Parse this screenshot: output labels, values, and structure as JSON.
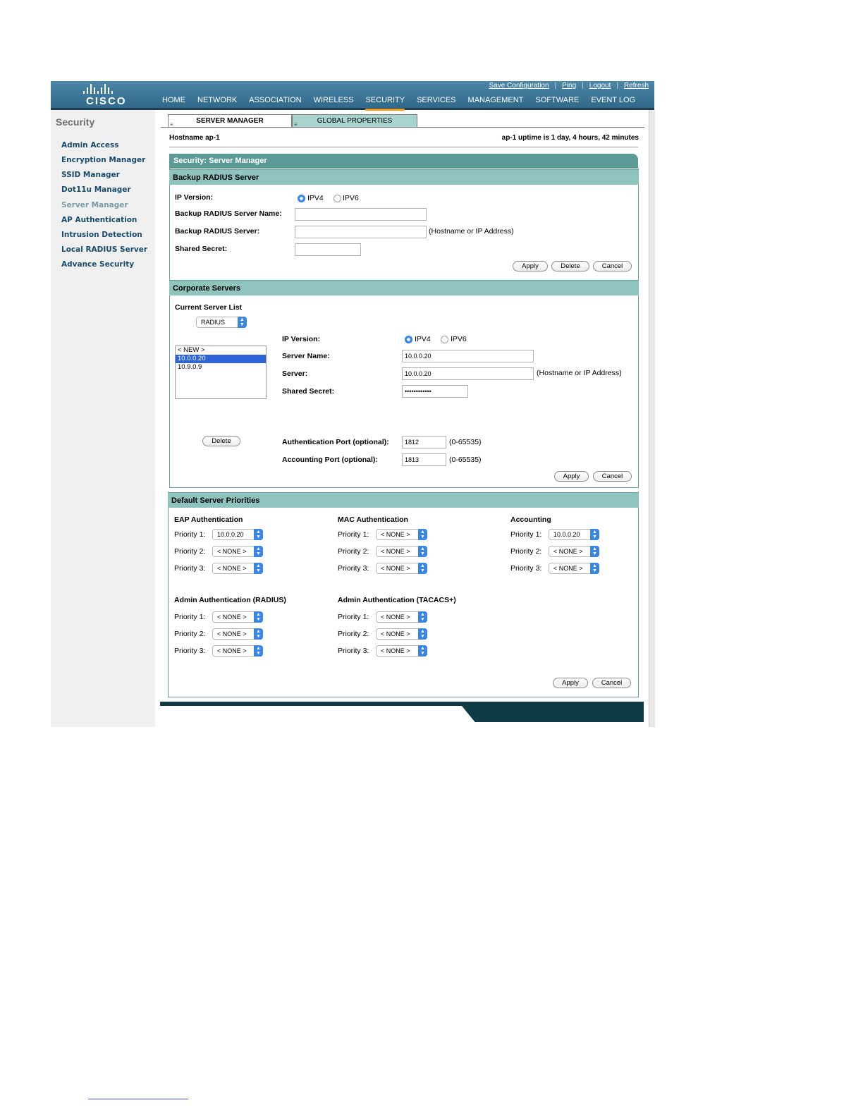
{
  "brand": {
    "logo_text": "CISCO"
  },
  "util_links": [
    "Save Configuration",
    "Ping",
    "Logout",
    "Refresh"
  ],
  "nav": [
    "HOME",
    "NETWORK",
    "ASSOCIATION",
    "WIRELESS",
    "SECURITY",
    "SERVICES",
    "MANAGEMENT",
    "SOFTWARE",
    "EVENT LOG"
  ],
  "nav_active": "SECURITY",
  "sidebar": {
    "title": "Security",
    "items": [
      "Admin Access",
      "Encryption Manager",
      "SSID Manager",
      "Dot11u Manager",
      "Server Manager",
      "AP Authentication",
      "Intrusion Detection",
      "Local RADIUS Server",
      "Advance Security"
    ],
    "current": "Server Manager"
  },
  "tabs": [
    "SERVER MANAGER",
    "GLOBAL PROPERTIES"
  ],
  "host": {
    "hostname_label": "Hostname  ap-1",
    "uptime": "ap-1 uptime is 1 day, 4 hours, 42 minutes"
  },
  "main_title": "Security: Server Manager",
  "backup": {
    "title": "Backup RADIUS Server",
    "ip_version_label": "IP Version:",
    "ipv4": "IPV4",
    "ipv6": "IPV6",
    "name_label": "Backup RADIUS Server Name:",
    "server_label": "Backup RADIUS Server:",
    "server_hint": "(Hostname or IP Address)",
    "secret_label": "Shared Secret:",
    "name_value": "",
    "server_value": "",
    "secret_value": "",
    "apply": "Apply",
    "delete": "Delete",
    "cancel": "Cancel"
  },
  "corporate": {
    "title": "Corporate Servers",
    "list_label": "Current Server List",
    "type_select": "RADIUS",
    "list_items": [
      "< NEW >",
      "10.0.0.20",
      "10.9.0.9"
    ],
    "selected_item": "10.0.0.20",
    "delete": "Delete",
    "ip_version_label": "IP Version:",
    "ipv4": "IPV4",
    "ipv6": "IPV6",
    "name_label": "Server Name:",
    "name_value": "10.0.0.20",
    "server_label": "Server:",
    "server_value": "10.0.0.20",
    "server_hint": "(Hostname or IP Address)",
    "secret_label": "Shared Secret:",
    "secret_value": "••••••••••••",
    "auth_port_label": "Authentication Port (optional):",
    "auth_port_value": "1812",
    "auth_port_range": "(0-65535)",
    "acct_port_label": "Accounting Port (optional):",
    "acct_port_value": "1813",
    "acct_port_range": "(0-65535)",
    "apply": "Apply",
    "cancel": "Cancel"
  },
  "priorities": {
    "title": "Default Server Priorities",
    "p1": "Priority 1:",
    "p2": "Priority 2:",
    "p3": "Priority 3:",
    "eap": {
      "title": "EAP Authentication",
      "values": [
        "10.0.0.20",
        "< NONE >",
        "< NONE >"
      ]
    },
    "mac": {
      "title": "MAC Authentication",
      "values": [
        "< NONE >",
        "< NONE >",
        "< NONE >"
      ]
    },
    "acct": {
      "title": "Accounting",
      "values": [
        "10.0.0.20",
        "< NONE >",
        "< NONE >"
      ]
    },
    "admin_radius": {
      "title": "Admin Authentication (RADIUS)",
      "values": [
        "< NONE >",
        "< NONE >",
        "< NONE >"
      ]
    },
    "admin_tacacs": {
      "title": "Admin Authentication (TACACS+)",
      "values": [
        "< NONE >",
        "< NONE >",
        "< NONE >"
      ]
    },
    "apply": "Apply",
    "cancel": "Cancel"
  }
}
